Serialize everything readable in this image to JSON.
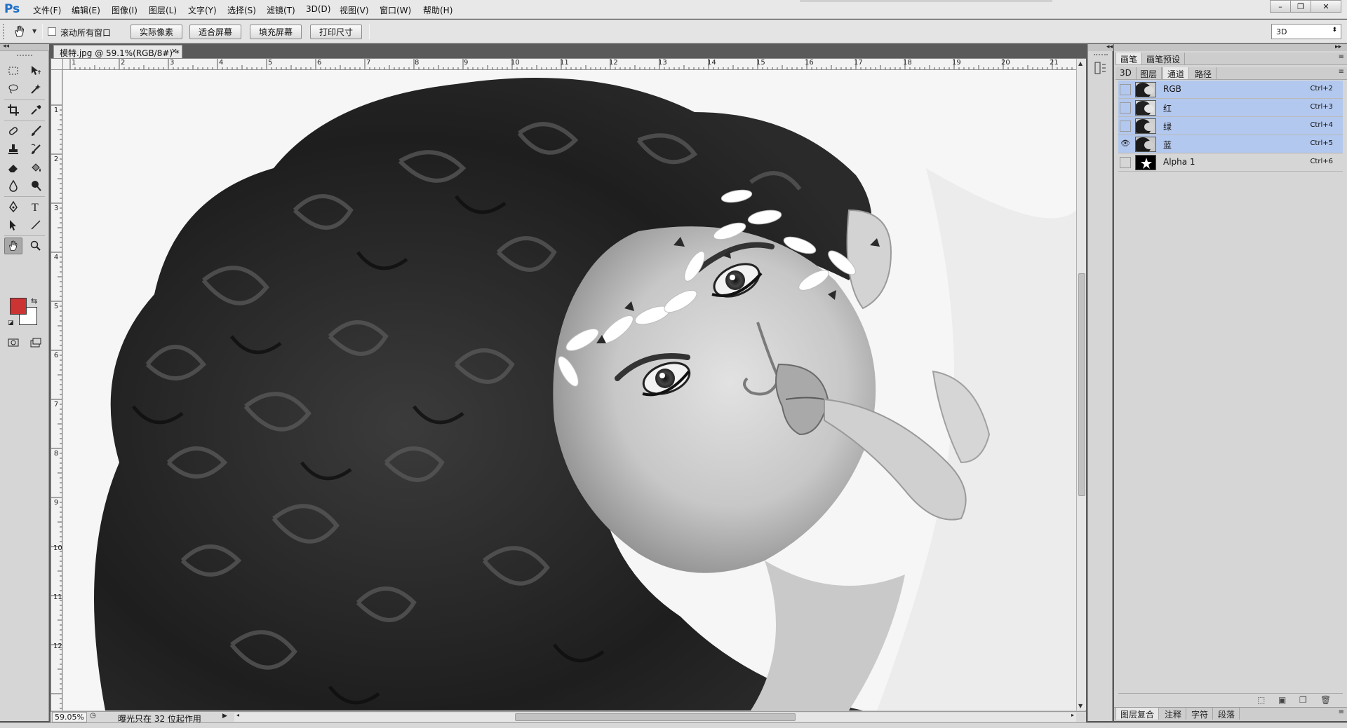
{
  "app": {
    "logo": "Ps",
    "menu": [
      "文件(F)",
      "编辑(E)",
      "图像(I)",
      "图层(L)",
      "文字(Y)",
      "选择(S)",
      "滤镜(T)",
      "3D(D)",
      "视图(V)",
      "窗口(W)",
      "帮助(H)"
    ],
    "window_controls": [
      "–",
      "❐",
      "✕"
    ]
  },
  "options_bar": {
    "scroll_all_windows_label": "滚动所有窗口",
    "scroll_all_windows_checked": false,
    "buttons": [
      "实际像素",
      "适合屏幕",
      "填充屏幕",
      "打印尺寸"
    ],
    "workspace": "3D"
  },
  "document": {
    "tab_title": "模特.jpg @ 59.1%(RGB/8#) *",
    "ruler_h": [
      "1",
      "2",
      "3",
      "4",
      "5",
      "6",
      "7",
      "8",
      "9",
      "10",
      "11",
      "12",
      "13",
      "14",
      "15",
      "16",
      "17",
      "18",
      "19",
      "20",
      "21"
    ],
    "ruler_v": [
      "1",
      "2",
      "3",
      "4",
      "5",
      "6",
      "7",
      "8",
      "9",
      "10",
      "11",
      "12"
    ],
    "status_zoom": "59.05%",
    "status_message": "曝光只在 32 位起作用"
  },
  "panels": {
    "top_tabs": [
      "画笔",
      "画笔预设"
    ],
    "second_tabs": [
      "3D",
      "图层",
      "通道",
      "路径"
    ],
    "active_tab": "通道",
    "channels": [
      {
        "name": "RGB",
        "shortcut": "Ctrl+2",
        "visible": false,
        "selected": true
      },
      {
        "name": "红",
        "shortcut": "Ctrl+3",
        "visible": false,
        "selected": true
      },
      {
        "name": "绿",
        "shortcut": "Ctrl+4",
        "visible": false,
        "selected": true
      },
      {
        "name": "蓝",
        "shortcut": "Ctrl+5",
        "visible": true,
        "selected": true
      },
      {
        "name": "Alpha 1",
        "shortcut": "Ctrl+6",
        "visible": false,
        "selected": false
      }
    ],
    "bottom_tabs": [
      "图层复合",
      "注释",
      "字符",
      "段落"
    ]
  },
  "colors": {
    "foreground": "#cc3333",
    "background": "#ffffff",
    "selection": "#b3c8ee"
  }
}
